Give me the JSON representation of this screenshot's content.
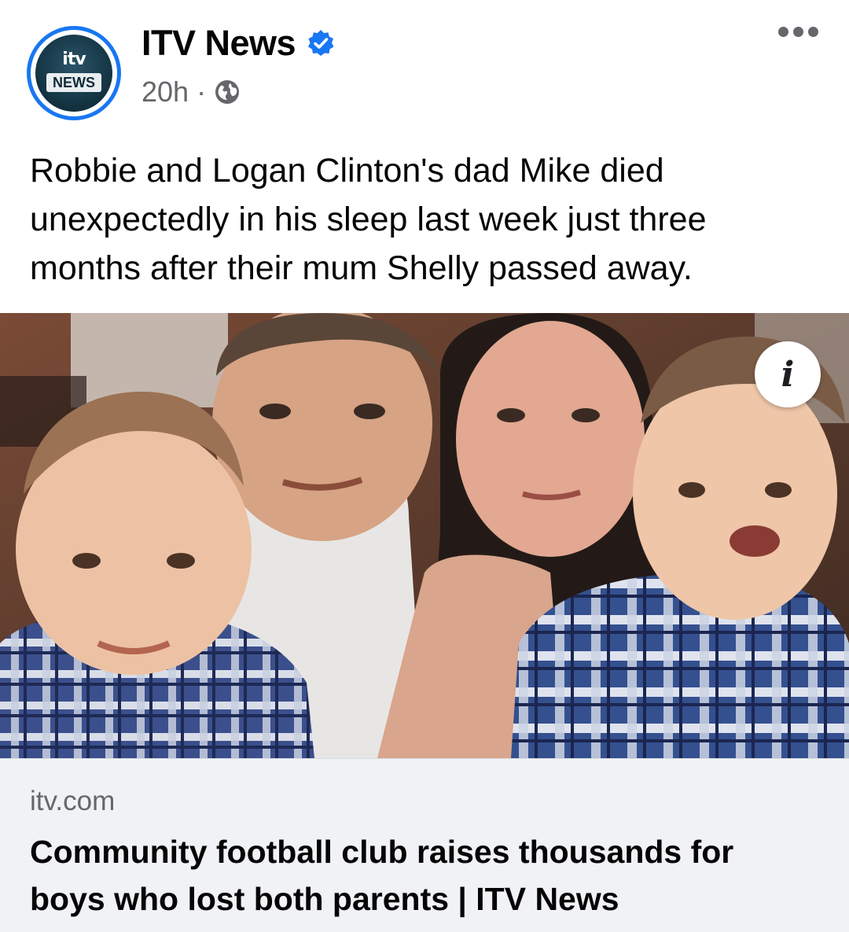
{
  "post": {
    "page_name": "ITV News",
    "verified": true,
    "time": "20h",
    "separator": "·",
    "audience_icon": "globe-icon",
    "avatar": {
      "brand_text": "itv",
      "label": "NEWS"
    },
    "caption": "Robbie and Logan Clinton's dad Mike died unexpectedly in his sleep last week just three months after their mum Shelly passed away.",
    "more_icon": "more-options-icon",
    "image": {
      "info_icon_glyph": "i"
    },
    "link": {
      "domain": "itv.com",
      "headline": "Community football club raises thousands for boys who lost both parents | ITV News"
    }
  },
  "colors": {
    "verified_blue": "#1877f2",
    "meta_gray": "#65676b",
    "link_bg": "#f0f2f5",
    "text": "#050505"
  }
}
